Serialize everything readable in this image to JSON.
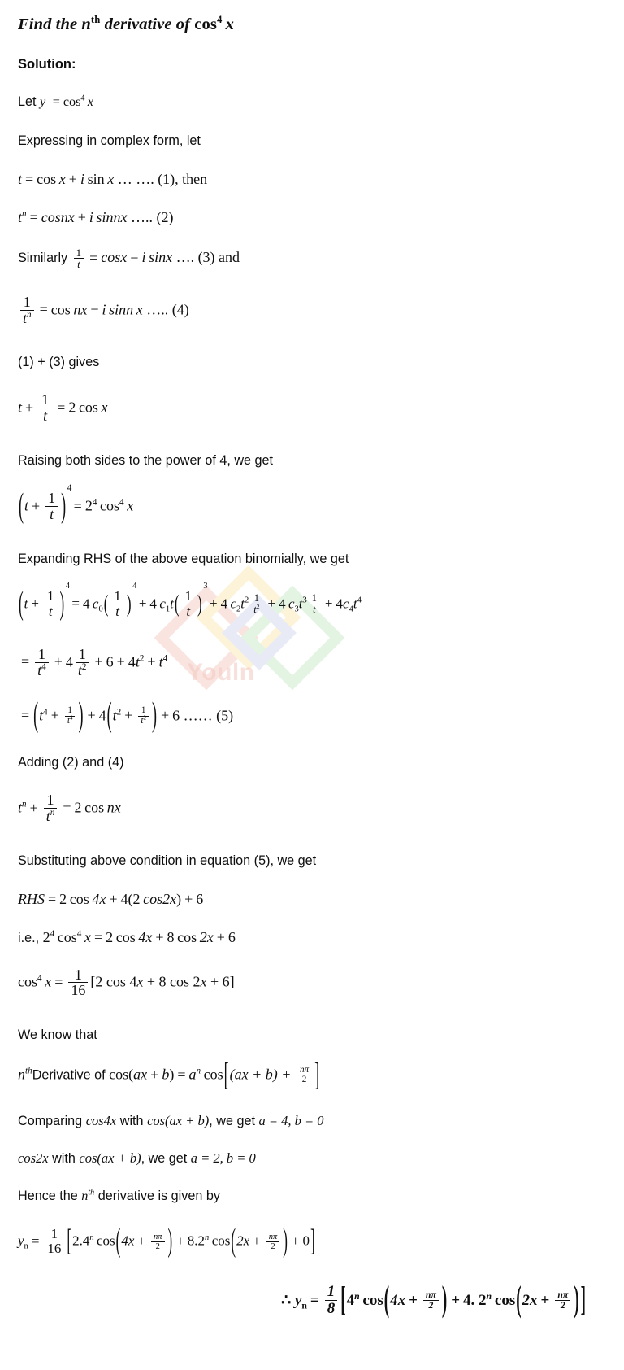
{
  "document": {
    "title_prefix": "Find the n",
    "title_sup": "th",
    "title_mid": " derivative of ",
    "title_fn": "cos",
    "title_fn_pow": "4",
    "title_var": "x",
    "solution_label": "Solution:"
  },
  "steps": {
    "let_label": "Let",
    "let_y": "y",
    "eq_sign": "=",
    "cos": "cos",
    "pow4": "4",
    "x": "x",
    "expressing": "Expressing in complex form, let",
    "eq1_t": "t",
    "eq1_cos": "cos",
    "eq1_x": "x",
    "eq1_plus": "+",
    "eq1_i": "i",
    "eq1_sin": "sin",
    "eq1_dots": "… …. (1), then",
    "eq2_t": "t",
    "eq2_n": "n",
    "eq2_cosnx": "cosnx",
    "eq2_plus": "+",
    "eq2_i": "i",
    "eq2_sinnx": "sinnx",
    "eq2_dots": "….. (2)",
    "eq3_similarly": "Similarly",
    "eq3_one": "1",
    "eq3_t": "t",
    "eq3_cosx": "cosx",
    "eq3_minus": "−",
    "eq3_i": "i",
    "eq3_sinx": "sinx",
    "eq3_dots": "…. (3) and",
    "eq4_one": "1",
    "eq4_t": "t",
    "eq4_n": "n",
    "eq4_cos": "cos",
    "eq4_nx": "nx",
    "eq4_minus": "−",
    "eq4_i": "i",
    "eq4_sinn": "sinn",
    "eq4_x": "x",
    "eq4_dots": "….. (4)",
    "gives_line": "(1) + (3) gives",
    "eq5a_t": "t",
    "eq5a_plus": "+",
    "eq5a_one": "1",
    "eq5a_den": "t",
    "eq5a_eq": "=",
    "eq5a_two": "2",
    "eq5a_cos": "cos",
    "eq5a_x": "x",
    "raising": "Raising both sides to the power of 4, we get",
    "pow_lhs_t": "t",
    "pow_lhs_plus": "+",
    "pow_lhs_one": "1",
    "pow_lhs_den": "t",
    "pow_outer": "4",
    "pow_rhs_two": "2",
    "pow_rhs_exp": "4",
    "pow_rhs_cos": "cos",
    "pow_rhs_cospow": "4",
    "pow_rhs_x": "x",
    "expanding": "Expanding RHS of the above equation binomially, we get",
    "bin_four": "4",
    "bin_c": "c",
    "bin_c0": "0",
    "bin_c1": "1",
    "bin_c2": "2",
    "bin_c3": "3",
    "bin_c4": "4",
    "bin_t": "t",
    "bin_one": "1",
    "simplify_one": "1",
    "simplify_t4": "t",
    "simplify_exp4": "4",
    "simplify_plus": "+",
    "simplify_four": "4",
    "simplify_t2": "t",
    "simplify_exp2": "2",
    "simplify_six": "6",
    "grouped_eqnum": "…… (5)",
    "adding_line": "Adding (2) and (4)",
    "addeq_t": "t",
    "addeq_n": "n",
    "addeq_one": "1",
    "addeq_eq": "=",
    "addeq_two": "2",
    "addeq_cos": "cos",
    "addeq_nx": "nx",
    "substituting": "Substituting above condition in equation (5), we get",
    "rhs_label": "RHS",
    "rhs_eq": "=",
    "rhs_two": "2",
    "rhs_cos": "cos",
    "rhs_4x": "4x",
    "rhs_plus": "+",
    "rhs_four": "4",
    "rhs_inner_two": "2",
    "rhs_cos2x": "cos2x",
    "rhs_six": "6",
    "ie_label": "i.e.,",
    "ie_two": "2",
    "ie_exp4": "4",
    "ie_cos": "cos",
    "ie_cospow": "4",
    "ie_x": "x",
    "ie_eq": "=",
    "ie_2": "2",
    "ie_cos4x": "cos",
    "ie_4x": "4x",
    "ie_plus": "+",
    "ie_eight": "8",
    "ie_cos2": "cos",
    "ie_2x": "2x",
    "ie_six": "6",
    "cos4_lhs": "cos",
    "cos4_pow": "4",
    "cos4_x": "x",
    "cos4_eq": "=",
    "cos4_num": "1",
    "cos4_den": "16",
    "cos4_body_a": "[2 cos 4",
    "cos4_body_b": "x",
    "cos4_body_c": " + 8 cos 2",
    "cos4_body_d": "x",
    "cos4_body_e": " + 6]",
    "we_know": "We know that",
    "deriv_n": "n",
    "deriv_th": "th",
    "deriv_label": "Derivative of ",
    "deriv_cos": "cos(",
    "deriv_ax": "ax",
    "deriv_plus": "+",
    "deriv_b": "b",
    "deriv_close": ")",
    "deriv_eq": "=",
    "deriv_a": "a",
    "deriv_an": "n",
    "deriv_cos2": "cos",
    "deriv_inner": "(ax + b) + ",
    "deriv_npi": "nπ",
    "deriv_two": "2",
    "compare1_pre": "Comparing ",
    "compare1_fn": "cos4x",
    "compare1_mid": " with ",
    "compare1_target": "cos(ax + b)",
    "compare1_post": ", we get ",
    "compare1_a": "a = 4, b = 0",
    "compare2_fn": "cos2x",
    "compare2_mid": " with ",
    "compare2_target": "cos(ax + b)",
    "compare2_post": ", we get ",
    "compare2_a": "a = 2, b = 0",
    "hence_pre": "Hence the ",
    "hence_n": "n",
    "hence_th": "th",
    "hence_post": " derivative is given by",
    "yn_y": "y",
    "yn_sub": "n",
    "yn_eq": "=",
    "yn_num": "1",
    "yn_den": "16",
    "yn_a": "2.4",
    "yn_an": "n",
    "yn_cos": "cos",
    "yn_4x": "4x",
    "yn_plus": "+",
    "yn_npi": "nπ",
    "yn_2": "2",
    "yn_b": "8.2",
    "yn_bn": "n",
    "yn_2x": "2x",
    "yn_zero": "0",
    "final_therefore": "∴",
    "final_y": "y",
    "final_sub": "n",
    "final_eq": "=",
    "final_num": "1",
    "final_den": "8",
    "final_a": "4",
    "final_an": "n",
    "final_cos": "cos",
    "final_4x": "4x",
    "final_plus": "+",
    "final_npi": "nπ",
    "final_2": "2",
    "final_dot": "4.",
    "final_b": "2",
    "final_bn": "n",
    "final_2x": "2x"
  },
  "watermark": {
    "text": "Youln",
    "colors": [
      "#f4b9b0",
      "#f7dc93",
      "#bfe0bd",
      "#c2c9e8"
    ]
  }
}
